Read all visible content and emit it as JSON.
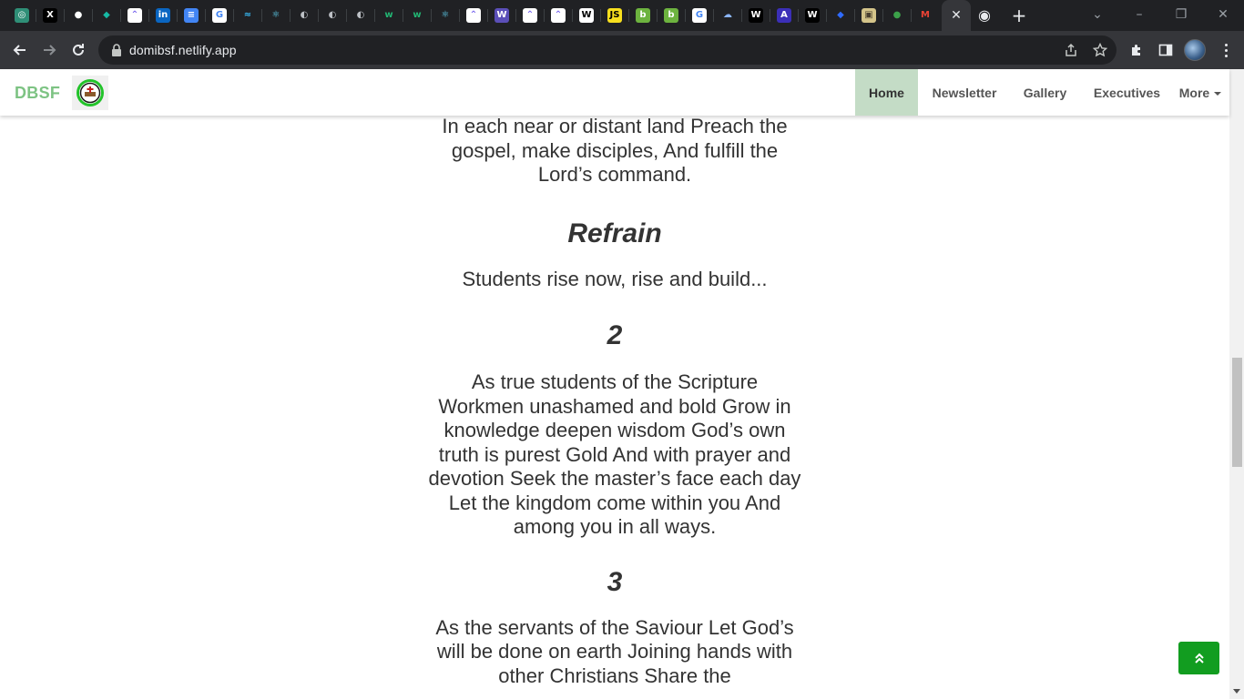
{
  "browser": {
    "active_tab_close": "✕",
    "new_tab": "+",
    "window_controls": {
      "tab_search": "⌄",
      "minimize": "–",
      "restore": "❐",
      "close": "✕"
    },
    "url": "domibsf.netlify.app",
    "tab_icons": [
      {
        "name": "chatgpt-icon",
        "glyph": "◎",
        "bg": "#2f8f77"
      },
      {
        "name": "x-icon",
        "glyph": "X",
        "bg": "#000000"
      },
      {
        "name": "github-icon",
        "glyph": "●",
        "bg": "#202124"
      },
      {
        "name": "diamond-app-icon",
        "glyph": "◆",
        "bg": "#202124",
        "fg": "#16b9a4"
      },
      {
        "name": "clickup-icon",
        "glyph": "⌃",
        "bg": "#ffffff",
        "fg": "#7b68ee"
      },
      {
        "name": "linkedin-icon",
        "glyph": "in",
        "bg": "#0a66c2"
      },
      {
        "name": "google-docs-icon",
        "glyph": "≡",
        "bg": "#4285f4"
      },
      {
        "name": "google-icon",
        "glyph": "G",
        "bg": "#ffffff",
        "fg": "#4285f4"
      },
      {
        "name": "tailwind-icon",
        "glyph": "≈",
        "bg": "#202124",
        "fg": "#38bdf8"
      },
      {
        "name": "react-icon",
        "glyph": "⚛",
        "bg": "#202124",
        "fg": "#61dafb"
      },
      {
        "name": "globe-icon",
        "glyph": "◐",
        "bg": "#202124",
        "fg": "#bdc1c6"
      },
      {
        "name": "globe-icon",
        "glyph": "◐",
        "bg": "#202124",
        "fg": "#bdc1c6"
      },
      {
        "name": "globe-icon",
        "glyph": "◐",
        "bg": "#202124",
        "fg": "#bdc1c6"
      },
      {
        "name": "w-app-icon",
        "glyph": "w",
        "bg": "#202124",
        "fg": "#22b573"
      },
      {
        "name": "w-app-icon",
        "glyph": "w",
        "bg": "#202124",
        "fg": "#22b573"
      },
      {
        "name": "react-icon",
        "glyph": "⚛",
        "bg": "#202124",
        "fg": "#61dafb"
      },
      {
        "name": "clickup-icon",
        "glyph": "⌃",
        "bg": "#ffffff",
        "fg": "#7b68ee"
      },
      {
        "name": "w3-validator-icon",
        "glyph": "W",
        "bg": "#5b4fb8"
      },
      {
        "name": "clickup-icon",
        "glyph": "⌃",
        "bg": "#ffffff",
        "fg": "#7b68ee"
      },
      {
        "name": "clickup-icon",
        "glyph": "⌃",
        "bg": "#ffffff",
        "fg": "#7b68ee"
      },
      {
        "name": "wikipedia-icon",
        "glyph": "W",
        "bg": "#ffffff",
        "fg": "#000000"
      },
      {
        "name": "javascript-icon",
        "glyph": "JS",
        "bg": "#f7df1e",
        "fg": "#000000"
      },
      {
        "name": "b-app-icon",
        "glyph": "b",
        "bg": "#6db33f"
      },
      {
        "name": "b-app-icon",
        "glyph": "b",
        "bg": "#6db33f"
      },
      {
        "name": "google-icon",
        "glyph": "G",
        "bg": "#ffffff",
        "fg": "#4285f4"
      },
      {
        "name": "cloud-app-icon",
        "glyph": "☁",
        "bg": "#202124",
        "fg": "#8ab4f8"
      },
      {
        "name": "wwt-icon",
        "glyph": "W",
        "bg": "#000000"
      },
      {
        "name": "a-app-icon",
        "glyph": "A",
        "bg": "#3b2fb8"
      },
      {
        "name": "wwt-icon",
        "glyph": "W",
        "bg": "#000000"
      },
      {
        "name": "diamond-blue-icon",
        "glyph": "◆",
        "bg": "#202124",
        "fg": "#2f6bff"
      },
      {
        "name": "photo-app-icon",
        "glyph": "▣",
        "bg": "#d4c48a",
        "fg": "#4a4030"
      },
      {
        "name": "earth-icon",
        "glyph": "●",
        "bg": "#202124",
        "fg": "#3ca14a"
      },
      {
        "name": "gmail-icon",
        "glyph": "M",
        "bg": "#202124",
        "fg": "#ea4335"
      }
    ],
    "last_tab_icon": {
      "name": "chrome-icon",
      "glyph": "◉"
    }
  },
  "navbar": {
    "brand": "DBSF",
    "items": [
      {
        "label": "Home",
        "active": true
      },
      {
        "label": "Newsletter",
        "active": false
      },
      {
        "label": "Gallery",
        "active": false
      },
      {
        "label": "Executives",
        "active": false
      },
      {
        "label": "More",
        "active": false
      }
    ]
  },
  "content": {
    "verse_end": "In each near or distant land Preach the gospel, make disciples, And fulfill the Lord’s command.",
    "refrain_heading": "Refrain",
    "refrain_text": "Students rise now, rise and build...",
    "verse2_heading": "2",
    "verse2_text": "As true students of the Scripture Workmen unashamed and bold Grow in knowledge deepen wisdom God’s own truth is purest Gold And with prayer and devotion Seek the master’s face each day Let the kingdom come within you And among you in all ways.",
    "verse3_heading": "3",
    "verse3_text": "As the servants of the Saviour Let God’s will be done on earth Joining hands with other Christians Share the"
  },
  "colors": {
    "brand": "#7dc383",
    "nav_active_bg": "#c4dcc6",
    "back_to_top": "#129d20"
  }
}
